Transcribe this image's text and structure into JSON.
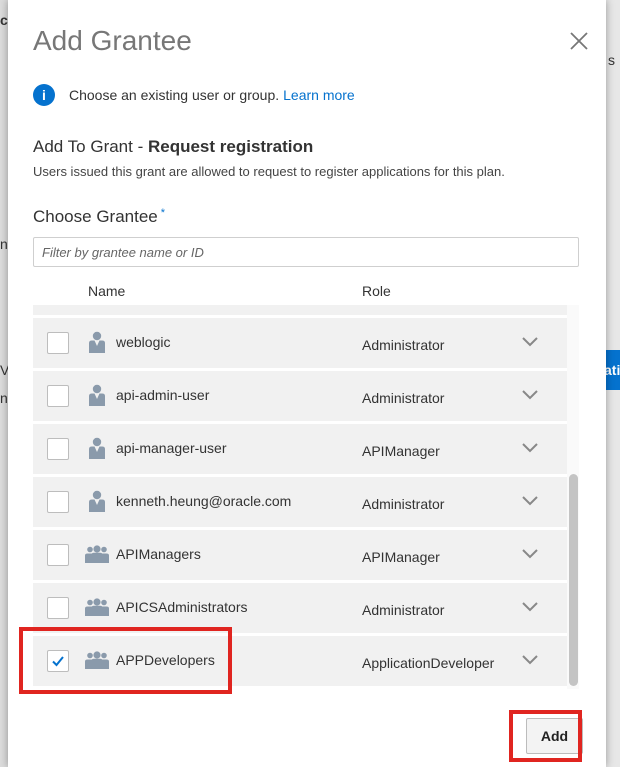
{
  "background": {
    "left_fragment_1": "ck",
    "left_fragment_2": "n",
    "left_fragment_3": "Vi",
    "left_fragment_4": "n",
    "right_fragment_1": "s",
    "right_button_fragment": "atio"
  },
  "dialog": {
    "title": "Add Grantee",
    "info_text": "Choose an existing user or group.",
    "learn_more": "Learn more",
    "grant_heading_prefix": "Add To Grant - ",
    "grant_heading_name": "Request registration",
    "grant_description": "Users issued this grant are allowed to request to register applications for this plan.",
    "choose_label": "Choose Grantee",
    "required_mark": "*",
    "filter_placeholder": "Filter by grantee name or ID",
    "filter_value": "",
    "columns": {
      "name": "Name",
      "role": "Role"
    },
    "rows": [
      {
        "type": "user",
        "name": "weblogic",
        "role": "Administrator",
        "checked": false
      },
      {
        "type": "user",
        "name": "api-admin-user",
        "role": "Administrator",
        "checked": false
      },
      {
        "type": "user",
        "name": "api-manager-user",
        "role": "APIManager",
        "checked": false
      },
      {
        "type": "user",
        "name": "kenneth.heung@oracle.com",
        "role": "Administrator",
        "checked": false
      },
      {
        "type": "group",
        "name": "APIManagers",
        "role": "APIManager",
        "checked": false
      },
      {
        "type": "group",
        "name": "APICSAdministrators",
        "role": "Administrator",
        "checked": false
      },
      {
        "type": "group",
        "name": "APPDevelopers",
        "role": "ApplicationDeveloper",
        "checked": true
      }
    ],
    "add_button": "Add"
  },
  "colors": {
    "accent": "#0572ce",
    "highlight": "#e02520",
    "row_bg": "#f1f1f1",
    "icon": "#8a9aab"
  },
  "icons": {
    "close": "close-icon",
    "info": "info-icon",
    "user": "user-icon",
    "group": "group-icon",
    "expand": "chevron-down-icon",
    "check": "checkmark-icon"
  }
}
